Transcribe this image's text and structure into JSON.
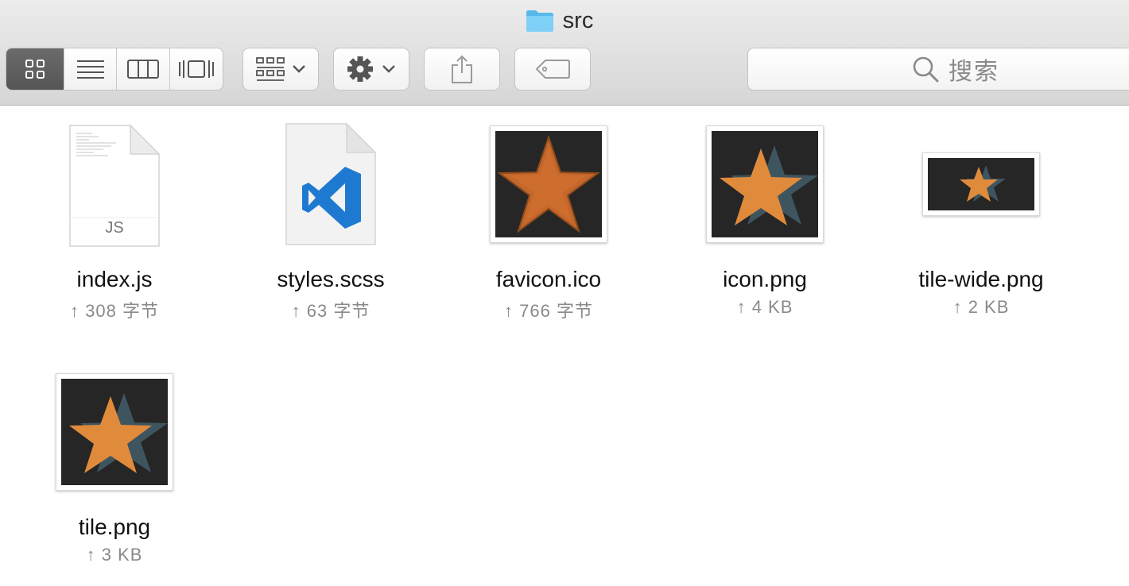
{
  "window": {
    "title": "src"
  },
  "toolbar": {
    "view_modes": [
      {
        "name": "icon-view",
        "active": true
      },
      {
        "name": "list-view",
        "active": false
      },
      {
        "name": "column-view",
        "active": false
      },
      {
        "name": "cover-flow-view",
        "active": false
      }
    ],
    "search_placeholder": "搜索"
  },
  "files": [
    {
      "name": "index.js",
      "size": "↑ 308 字节",
      "kind": "js",
      "badge": "JS"
    },
    {
      "name": "styles.scss",
      "size": "↑ 63 字节",
      "kind": "vscode"
    },
    {
      "name": "favicon.ico",
      "size": "↑ 766 字节",
      "kind": "star-flat"
    },
    {
      "name": "icon.png",
      "size": "↑ 4 KB",
      "kind": "star-3d"
    },
    {
      "name": "tile-wide.png",
      "size": "↑ 2 KB",
      "kind": "star-wide"
    },
    {
      "name": "tile.png",
      "size": "↑ 3 KB",
      "kind": "star-3d"
    }
  ],
  "colors": {
    "star_orange": "#e08a3c",
    "star_shadow": "#3e5560",
    "thumb_bg": "#262626",
    "vscode_blue": "#1e7ad1",
    "folder_blue": "#6cc4f0"
  }
}
